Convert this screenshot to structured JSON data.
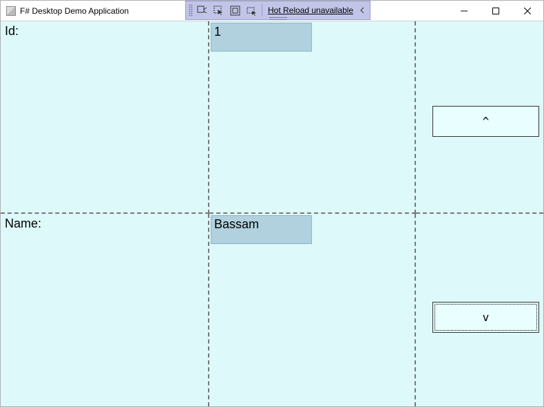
{
  "window": {
    "title": "F# Desktop Demo Application"
  },
  "debug_toolbar": {
    "hot_reload_label": "Hot Reload unavailable"
  },
  "form": {
    "id_label": "Id:",
    "id_value": "1",
    "name_label": "Name:",
    "name_value": "Bassam"
  },
  "nav": {
    "up_label": "^",
    "down_label": "v"
  }
}
